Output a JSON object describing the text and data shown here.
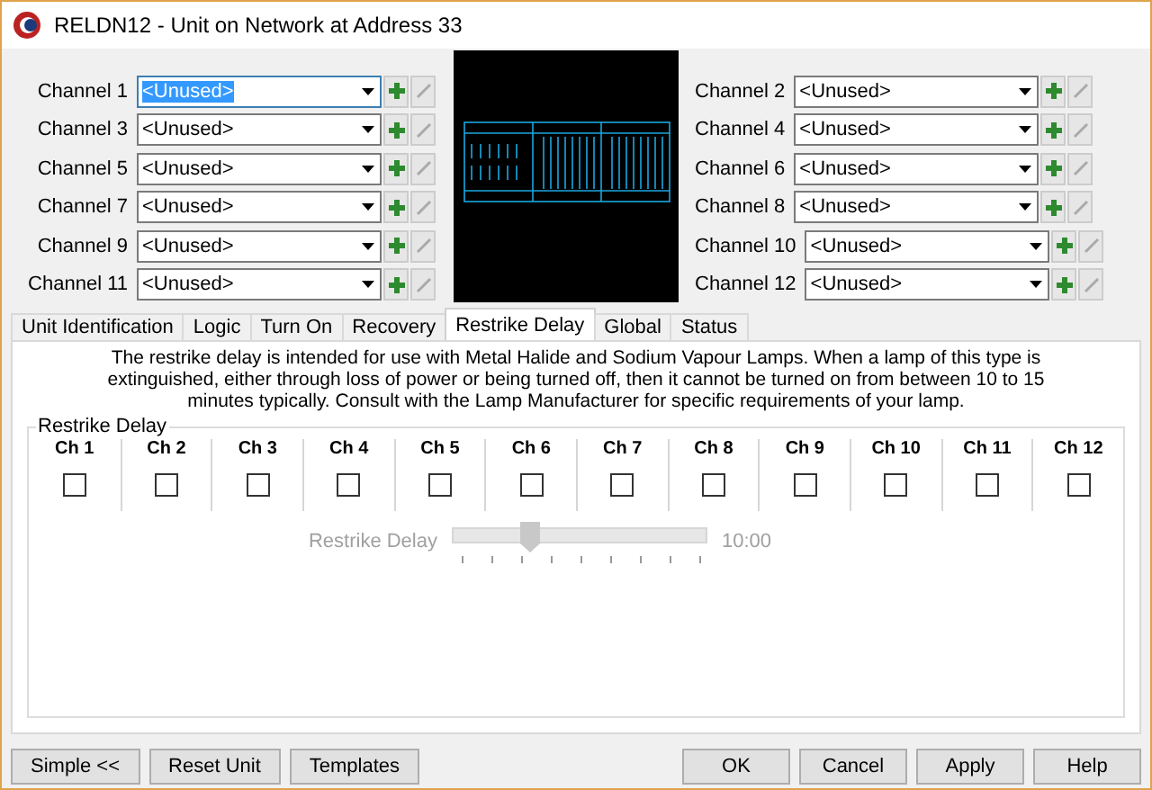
{
  "window": {
    "title": "RELDN12 - Unit on Network at Address 33"
  },
  "channels": [
    {
      "label": "Channel 1",
      "value": "<Unused>",
      "focused": true
    },
    {
      "label": "Channel 2",
      "value": "<Unused>",
      "focused": false
    },
    {
      "label": "Channel 3",
      "value": "<Unused>",
      "focused": false
    },
    {
      "label": "Channel 4",
      "value": "<Unused>",
      "focused": false
    },
    {
      "label": "Channel 5",
      "value": "<Unused>",
      "focused": false
    },
    {
      "label": "Channel 6",
      "value": "<Unused>",
      "focused": false
    },
    {
      "label": "Channel 7",
      "value": "<Unused>",
      "focused": false
    },
    {
      "label": "Channel 8",
      "value": "<Unused>",
      "focused": false
    },
    {
      "label": "Channel 9",
      "value": "<Unused>",
      "focused": false
    },
    {
      "label": "Channel 10",
      "value": "<Unused>",
      "focused": false
    },
    {
      "label": "Channel 11",
      "value": "<Unused>",
      "focused": false
    },
    {
      "label": "Channel 12",
      "value": "<Unused>",
      "focused": false
    }
  ],
  "tabs": [
    {
      "label": "Unit Identification",
      "selected": false
    },
    {
      "label": "Logic",
      "selected": false
    },
    {
      "label": "Turn On",
      "selected": false
    },
    {
      "label": "Recovery",
      "selected": false
    },
    {
      "label": "Restrike Delay",
      "selected": true
    },
    {
      "label": "Global",
      "selected": false
    },
    {
      "label": "Status",
      "selected": false
    }
  ],
  "description": "The restrike delay is intended for use with Metal Halide and Sodium Vapour Lamps. When a lamp of this type is extinguished, either through loss of power or being turned off, then it cannot be turned on from between 10 to 15 minutes typically. Consult with the Lamp Manufacturer for specific requirements of your lamp.",
  "group": {
    "title": "Restrike Delay",
    "columns": [
      {
        "label": "Ch 1",
        "checked": false
      },
      {
        "label": "Ch 2",
        "checked": false
      },
      {
        "label": "Ch 3",
        "checked": false
      },
      {
        "label": "Ch 4",
        "checked": false
      },
      {
        "label": "Ch 5",
        "checked": false
      },
      {
        "label": "Ch 6",
        "checked": false
      },
      {
        "label": "Ch 7",
        "checked": false
      },
      {
        "label": "Ch 8",
        "checked": false
      },
      {
        "label": "Ch 9",
        "checked": false
      },
      {
        "label": "Ch 10",
        "checked": false
      },
      {
        "label": "Ch 11",
        "checked": false
      },
      {
        "label": "Ch 12",
        "checked": false
      }
    ],
    "slider": {
      "label": "Restrike Delay",
      "level": 0.3,
      "reading": "10:00",
      "disabled": true
    }
  },
  "buttons_left": [
    "Simple <<",
    "Reset Unit",
    "Templates"
  ],
  "buttons_right": [
    "OK",
    "Cancel",
    "Apply",
    "Help"
  ]
}
